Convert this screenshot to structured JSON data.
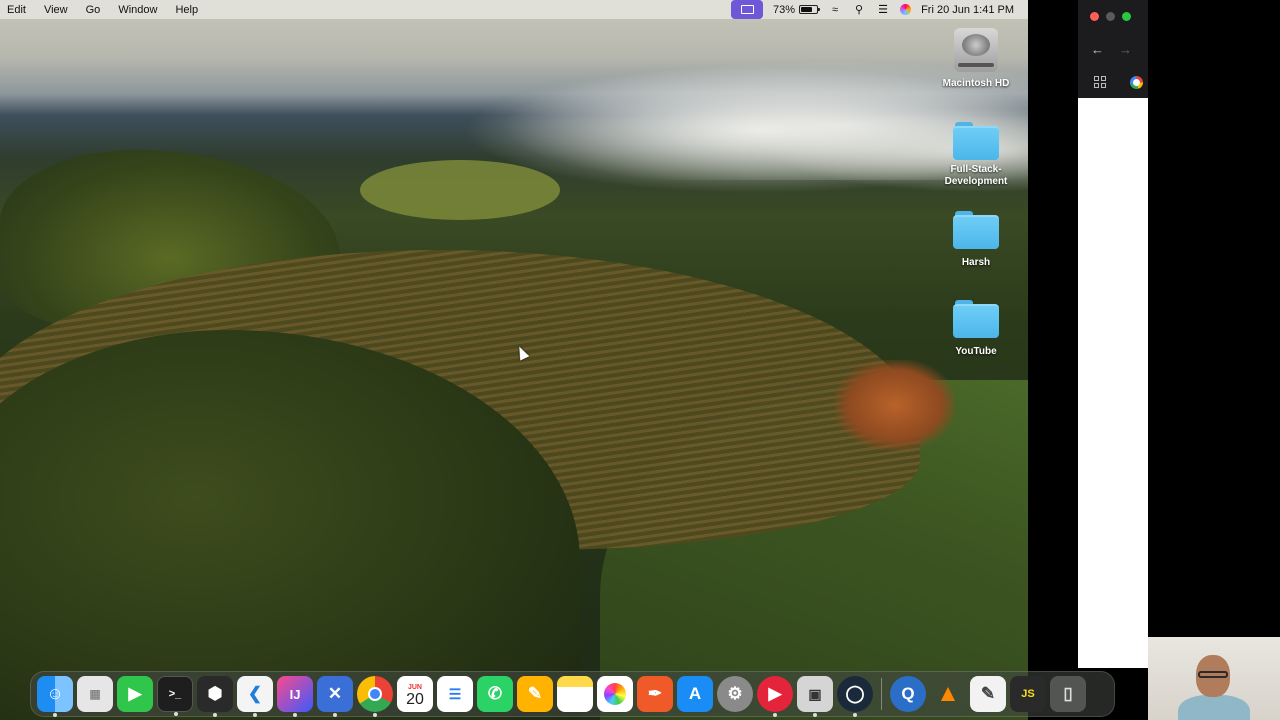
{
  "menubar": {
    "items": [
      "Edit",
      "View",
      "Go",
      "Window",
      "Help"
    ],
    "battery_percent": "73%",
    "datetime": "Fri 20 Jun  1:41 PM"
  },
  "desktop_icons": [
    {
      "label": "Macintosh HD",
      "icon": "hard-drive-icon"
    },
    {
      "label": "Full-Stack-Development",
      "icon": "folder-icon"
    },
    {
      "label": "Harsh",
      "icon": "folder-icon"
    },
    {
      "label": "YouTube",
      "icon": "folder-icon"
    }
  ],
  "dock": {
    "calendar_month": "JUN",
    "calendar_day": "20",
    "apps": [
      "finder",
      "launchpad",
      "facetime",
      "terminal",
      "cube-app",
      "vscode",
      "intellij",
      "xcode",
      "chrome",
      "calendar",
      "reminders",
      "whatsapp",
      "pages",
      "notes",
      "photos",
      "pencil-app",
      "app-store",
      "system-settings",
      "youtube-player",
      "preview",
      "activity-app",
      "quicktime",
      "vlc",
      "textedit",
      "js-app",
      "trash"
    ]
  },
  "colors": {
    "accent_purple": "#6e58d8",
    "folder_blue": "#4bb6ea",
    "close_red": "#ff5f57",
    "min_gray": "#5a5a5a",
    "max_green": "#28c840"
  }
}
